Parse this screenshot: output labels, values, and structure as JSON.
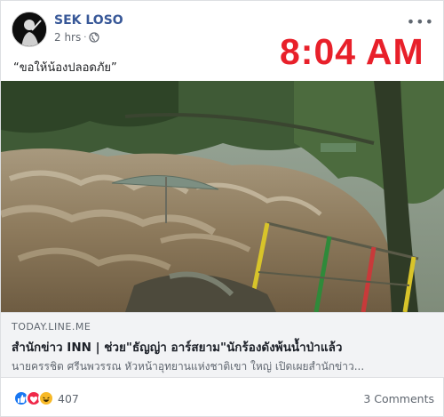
{
  "post": {
    "author": "SEK LOSO",
    "time_ago": "2 hrs",
    "separator": "·",
    "caption": "“ขอให้น้องปลอดภัย”",
    "more_label": "•••"
  },
  "overlay": {
    "clock": "8:04 AM",
    "color": "#e8202a"
  },
  "link_preview": {
    "domain": "TODAY.LINE.ME",
    "title": "สำนักข่าว INN | ช่วย\"ธัญญ่า อาร์สยาม\"นักร้องดังพ้นน้ำป่าแล้ว",
    "description": "นายครรชิต ศรีนพวรรณ หัวหน้าอุทยานแห่งชาติเขา ใหญ่ เปิดเผยสำนักข่าว..."
  },
  "engagement": {
    "reaction_icons": [
      "like-icon",
      "love-icon",
      "haha-icon"
    ],
    "reaction_count": "407",
    "comments": "3 Comments"
  },
  "colors": {
    "link_blue": "#385898",
    "like": "#1877f2",
    "love": "#f02849",
    "haha": "#f7b928"
  }
}
